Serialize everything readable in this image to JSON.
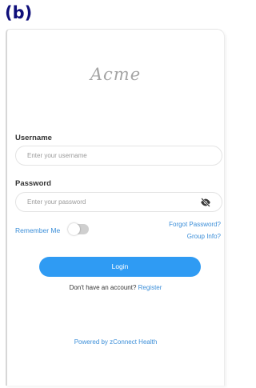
{
  "figure_label": "(b)",
  "app": {
    "logo_text": "Acme"
  },
  "form": {
    "username_label": "Username",
    "username_placeholder": "Enter your username",
    "password_label": "Password",
    "password_placeholder": "Enter your password",
    "remember_me_label": "Remember Me",
    "remember_me_on": false,
    "forgot_password_link": "Forgot Password?",
    "group_info_link": "Group Info?",
    "login_button": "Login",
    "no_account_text": "Don't have an account?",
    "register_link": "Register"
  },
  "footer": {
    "powered_by": "Powered by zConnect Health"
  },
  "colors": {
    "accent": "#2f9bf3",
    "link": "#3b8ed8",
    "label": "#0f0f7a"
  },
  "icons": {
    "password_visibility": "eye-slash-icon"
  }
}
